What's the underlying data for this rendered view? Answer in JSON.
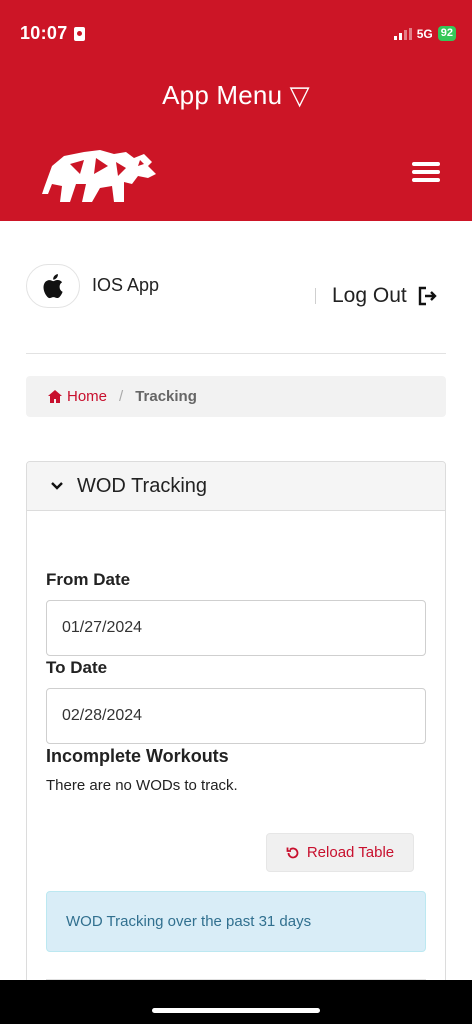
{
  "status_bar": {
    "time": "10:07",
    "network": "5G",
    "battery": "92"
  },
  "header": {
    "menu_title": "App Menu ▽",
    "logo": "rhino-logo",
    "menu_icon": "hamburger-icon",
    "brand_color": "#cc1526"
  },
  "account": {
    "app_icon": "apple-icon",
    "app_label": "IOS App",
    "logout_label": "Log Out",
    "logout_icon": "logout-icon"
  },
  "breadcrumb": {
    "home": "Home",
    "separator": "/",
    "current": "Tracking"
  },
  "wod_tracking": {
    "title": "WOD Tracking",
    "from_label": "From Date",
    "from_value": "01/27/2024",
    "to_label": "To Date",
    "to_value": "02/28/2024",
    "incomplete_label": "Incomplete Workouts",
    "empty_message": "There are no WODs to track.",
    "reload_label": "Reload Table",
    "info_text": "WOD Tracking over the past 31 days"
  },
  "colors": {
    "accent": "#c8102e",
    "info_bg": "#d9edf7",
    "info_text": "#31708f"
  }
}
